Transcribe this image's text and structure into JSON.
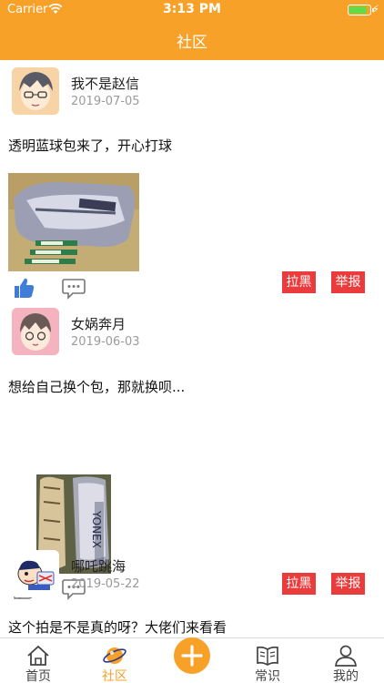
{
  "status": {
    "carrier": "Carrier",
    "time": "3:13 PM"
  },
  "nav": {
    "title": "社区"
  },
  "posts": [
    {
      "user": "我不是赵信",
      "date": "2019-07-05",
      "text": "透明蓝球包来了，开心打球",
      "liked": true,
      "actions": {
        "block": "拉黑",
        "report": "举报"
      }
    },
    {
      "user": "女娲奔月",
      "date": "2019-06-03",
      "text": "想给自己换个包，那就换呗...",
      "liked": false,
      "actions": {
        "block": "拉黑",
        "report": "举报"
      }
    },
    {
      "user": "哪吒跳海",
      "date": "2019-05-22",
      "text": "这个拍是不是真的呀？大佬们来看看",
      "liked": false
    }
  ],
  "tabs": [
    {
      "label": "首页",
      "icon": "home-icon",
      "active": false
    },
    {
      "label": "社区",
      "icon": "planet-icon",
      "active": true
    },
    {
      "label": "",
      "icon": "plus-icon",
      "active": false
    },
    {
      "label": "常识",
      "icon": "book-icon",
      "active": false
    },
    {
      "label": "我的",
      "icon": "person-icon",
      "active": false
    }
  ],
  "colors": {
    "brand": "#f7a128",
    "danger": "#ea3c3c",
    "like_active": "#3f7dd8"
  }
}
